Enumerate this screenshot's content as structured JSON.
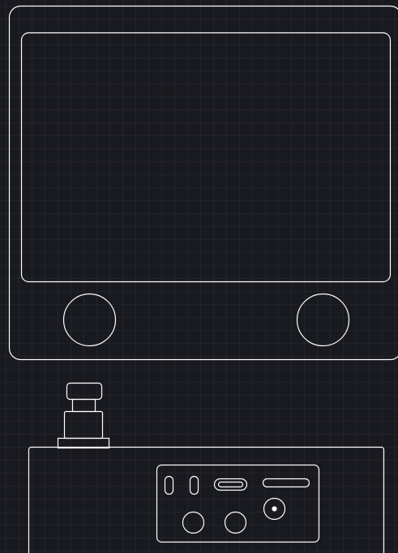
{
  "colors": {
    "background": "#191a1f",
    "grid": "#2a2c33",
    "stroke": "#ffffff"
  },
  "drawing": {
    "grid_visible": true,
    "style": "white line-art blueprint on dark grid",
    "parts": {
      "monitor": [
        "monitor-body",
        "screen-bezel",
        "left-speaker-knob",
        "right-speaker-knob"
      ],
      "button_assembly": [
        "button-cap",
        "button-neck",
        "button-shaft",
        "button-base-flange"
      ],
      "control_box": [
        "control-box-body",
        "io-panel"
      ],
      "io_panel": [
        "slot-port-1",
        "slot-port-2",
        "usb-c-port",
        "sd-card-slot",
        "audio-jack",
        "round-port-left",
        "round-port-right"
      ]
    }
  }
}
